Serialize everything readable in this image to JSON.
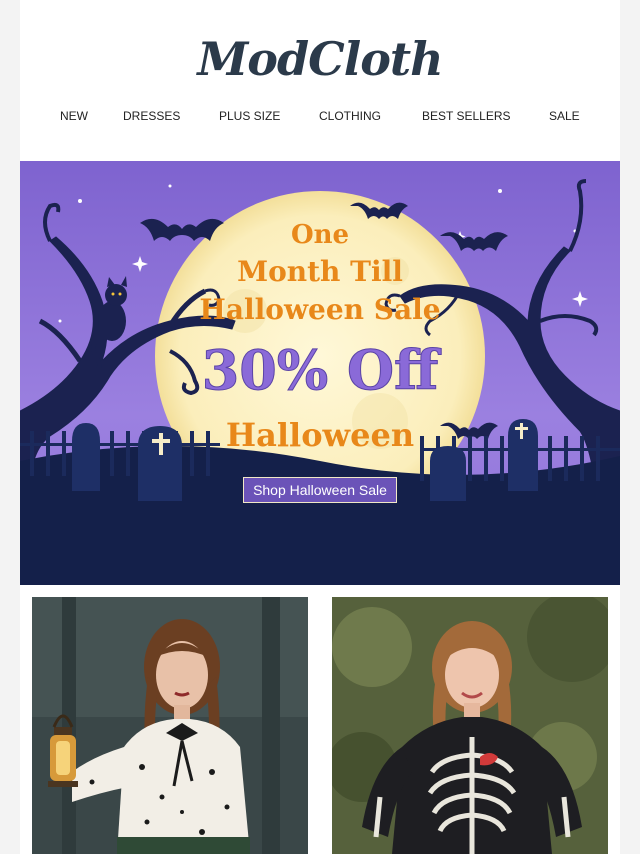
{
  "brand": {
    "logo_text": "ModCloth"
  },
  "nav": {
    "items": [
      "NEW",
      "DRESSES",
      "PLUS SIZE",
      "CLOTHING",
      "BEST SELLERS",
      "SALE"
    ]
  },
  "hero": {
    "line1": "One",
    "line2": "Month Till",
    "line3": "Halloween Sale",
    "discount": "30% Off",
    "line5": "Halloween",
    "cta_label": "Shop Halloween Sale"
  },
  "colors": {
    "brand": "#2b3a4a",
    "hero_purple": "#8c6fd6",
    "hero_navy": "#14204a",
    "moon": "#fbf2c9",
    "accent_orange": "#e8881a"
  },
  "products": [
    {
      "image": "lantern-blouse-photo"
    },
    {
      "image": "skeleton-sweater-photo"
    }
  ]
}
